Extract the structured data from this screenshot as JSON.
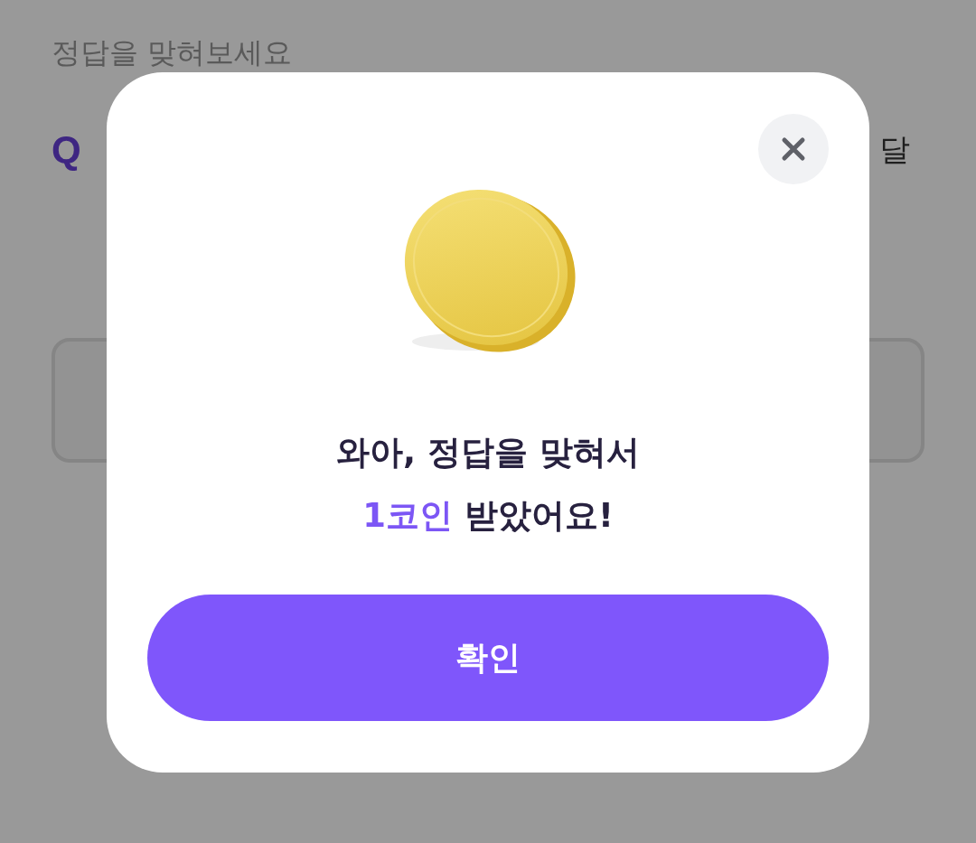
{
  "background_page": {
    "instruction": "정답을 맞혀보세요",
    "question_mark": "Q",
    "question_tail": "달"
  },
  "reward_dialog": {
    "message": {
      "line_1": "와아, 정답을 맞혀서",
      "amount": "1코인",
      "line_2_rest": "받았어요!"
    },
    "confirm_button": "확인"
  }
}
